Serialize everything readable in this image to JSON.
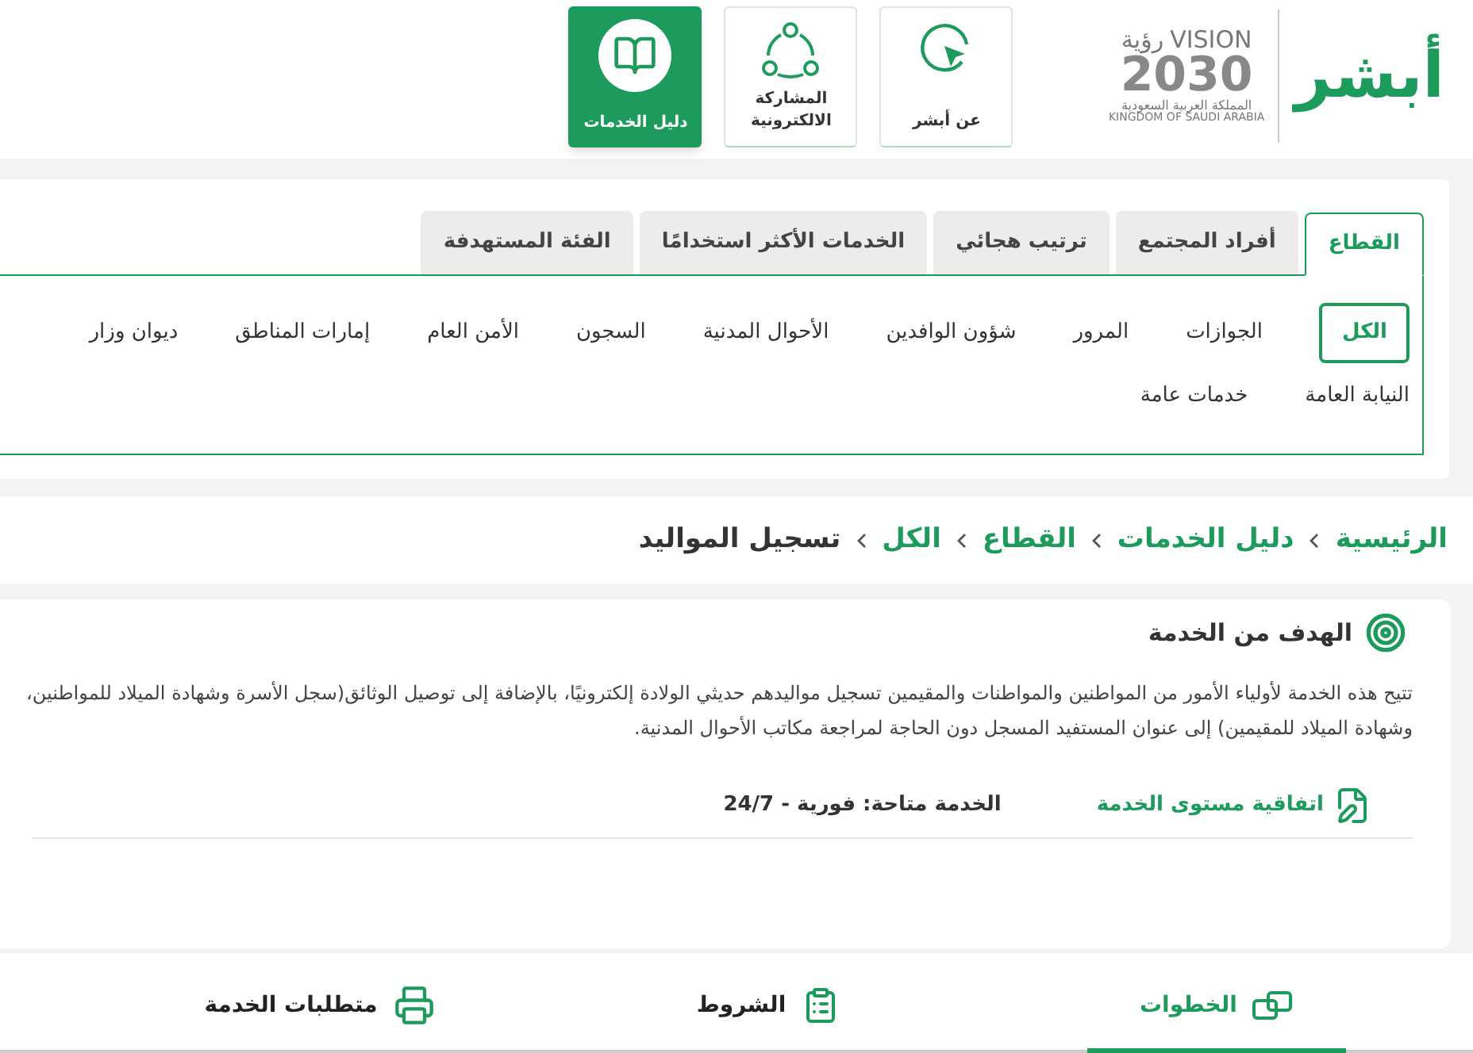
{
  "header": {
    "logo": {
      "brand": "أبشر",
      "vision_ar": "رؤية",
      "vision_en": "VISION",
      "year": "2030",
      "kingdom_ar": "المملكة العربية السعودية",
      "kingdom_en": "KINGDOM OF SAUDI ARABIA"
    },
    "nav": [
      {
        "label": "عن أبشر",
        "kind": "cursor",
        "selected": false
      },
      {
        "label": "المشاركة الالكترونية",
        "kind": "share",
        "selected": false
      },
      {
        "label": "دليل الخدمات",
        "kind": "book",
        "selected": true
      }
    ]
  },
  "filter_tabs": [
    {
      "label": "القطاع",
      "selected": true
    },
    {
      "label": "أفراد المجتمع",
      "selected": false
    },
    {
      "label": "ترتيب هجائي",
      "selected": false
    },
    {
      "label": "الخدمات الأكثر استخدامًا",
      "selected": false
    },
    {
      "label": "الفئة المستهدفة",
      "selected": false
    }
  ],
  "categories": {
    "rows": [
      [
        {
          "label": "الكل",
          "selected": true
        },
        {
          "label": "الجوازات",
          "selected": false
        },
        {
          "label": "المرور",
          "selected": false
        },
        {
          "label": "شؤون الوافدين",
          "selected": false
        },
        {
          "label": "الأحوال المدنية",
          "selected": false
        },
        {
          "label": "السجون",
          "selected": false
        },
        {
          "label": "الأمن العام",
          "selected": false
        },
        {
          "label": "إمارات المناطق",
          "selected": false
        },
        {
          "label": "ديوان وزار",
          "selected": false
        }
      ],
      [
        {
          "label": "النيابة العامة",
          "selected": false
        },
        {
          "label": "خدمات عامة",
          "selected": false
        }
      ]
    ]
  },
  "breadcrumb": [
    {
      "label": "الرئيسية",
      "current": false
    },
    {
      "label": "دليل الخدمات",
      "current": false
    },
    {
      "label": "القطاع",
      "current": false
    },
    {
      "label": "الكل",
      "current": false
    },
    {
      "label": "تسجيل المواليد",
      "current": true
    }
  ],
  "goal": {
    "title": "الهدف من الخدمة",
    "text": "تتيح هذه الخدمة لأولياء الأمور من المواطنين والمواطنات والمقيمين تسجيل مواليدهم حديثي الولادة إلكترونيًا، بالإضافة إلى توصيل الوثائق(سجل الأسرة وشهادة الميلاد للمواطنين، وشهادة الميلاد للمقيمين) إلى عنوان المستفيد المسجل دون الحاجة لمراجعة مكاتب الأحوال المدنية."
  },
  "sla": {
    "title": "اتفاقية مستوى الخدمة",
    "value": "الخدمة متاحة: فورية - 24/7"
  },
  "detail_tabs": [
    {
      "label": "الخطوات",
      "kind": "steps",
      "selected": true
    },
    {
      "label": "الشروط",
      "kind": "checklist",
      "selected": false
    },
    {
      "label": "متطلبات الخدمة",
      "kind": "requirements",
      "selected": false
    }
  ]
}
